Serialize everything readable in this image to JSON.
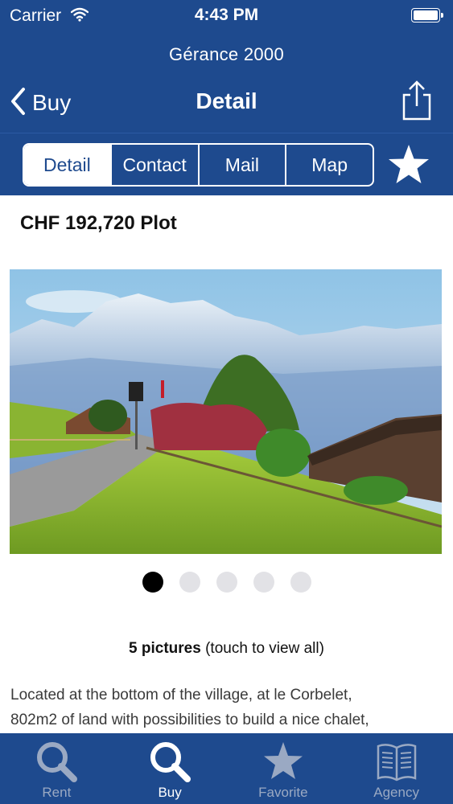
{
  "status_bar": {
    "carrier": "Carrier",
    "time": "4:43 PM"
  },
  "header": {
    "agency_name": "Gérance 2000",
    "back_label": "Buy",
    "title": "Detail"
  },
  "segments": [
    {
      "label": "Detail",
      "active": true
    },
    {
      "label": "Contact",
      "active": false
    },
    {
      "label": "Mail",
      "active": false
    },
    {
      "label": "Map",
      "active": false
    }
  ],
  "listing": {
    "price_title": "CHF 192,720 Plot",
    "photo_count": "5 pictures",
    "photo_hint": "(touch to view all)",
    "current_photo": 1,
    "total_photos": 5,
    "description_line1": "Located at the bottom of the village, at le Corbelet,",
    "description_line2": "802m2 of land with possibilities to build a nice chalet,"
  },
  "tabbar": [
    {
      "label": "Rent",
      "icon": "search-icon",
      "active": false
    },
    {
      "label": "Buy",
      "icon": "search-icon",
      "active": true
    },
    {
      "label": "Favorite",
      "icon": "star-icon",
      "active": false
    },
    {
      "label": "Agency",
      "icon": "book-icon",
      "active": false
    }
  ],
  "colors": {
    "brand_blue": "#1e4a8e",
    "inactive_tab": "#9aa9c3"
  }
}
